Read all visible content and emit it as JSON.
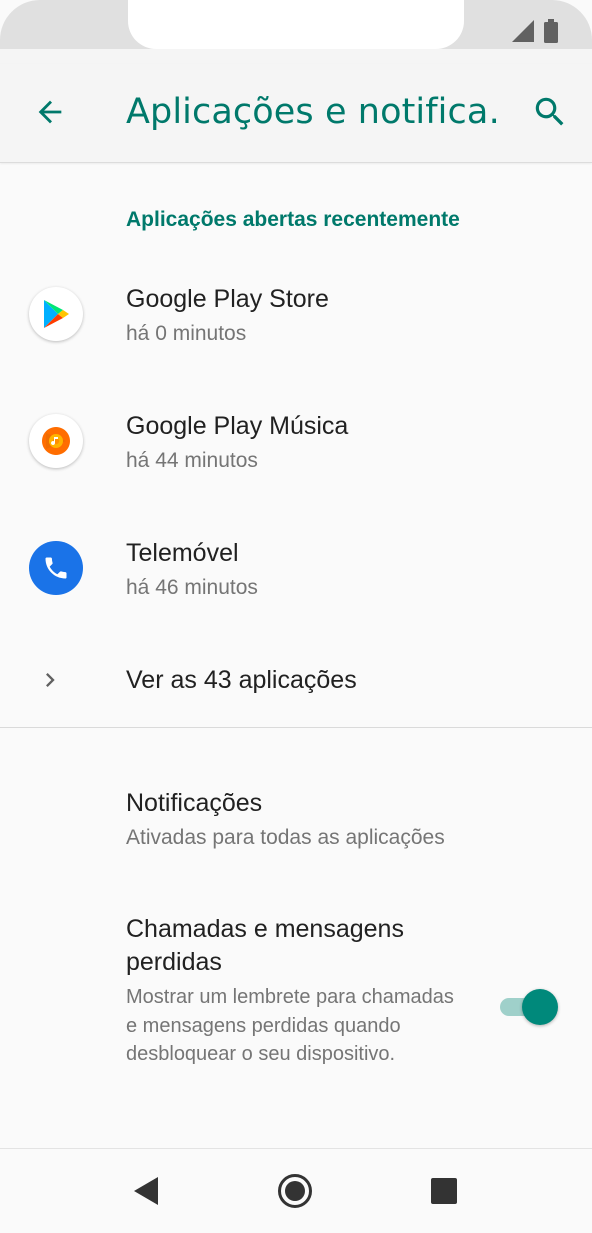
{
  "appbar": {
    "title": "Aplicações e notifica…"
  },
  "section": {
    "recent_header": "Aplicações abertas recentemente"
  },
  "recent_apps": [
    {
      "name": "Google Play Store",
      "time": "há 0 minutos",
      "icon": "play-store-icon"
    },
    {
      "name": "Google Play Música",
      "time": "há 44 minutos",
      "icon": "play-music-icon"
    },
    {
      "name": "Telemóvel",
      "time": "há 46 minutos",
      "icon": "phone-icon"
    }
  ],
  "see_all": {
    "label": "Ver as 43 aplicações"
  },
  "notifications": {
    "title": "Notificações",
    "subtitle": "Ativadas para todas as aplicações"
  },
  "missed": {
    "title": "Chamadas e mensagens perdidas",
    "description": "Mostrar um lembrete para chamadas e mensagens perdidas quando desbloquear o seu dispositivo.",
    "enabled": true
  },
  "colors": {
    "accent": "#00796b",
    "toggle_on": "#00897b",
    "phone_blue": "#1a73e8"
  }
}
